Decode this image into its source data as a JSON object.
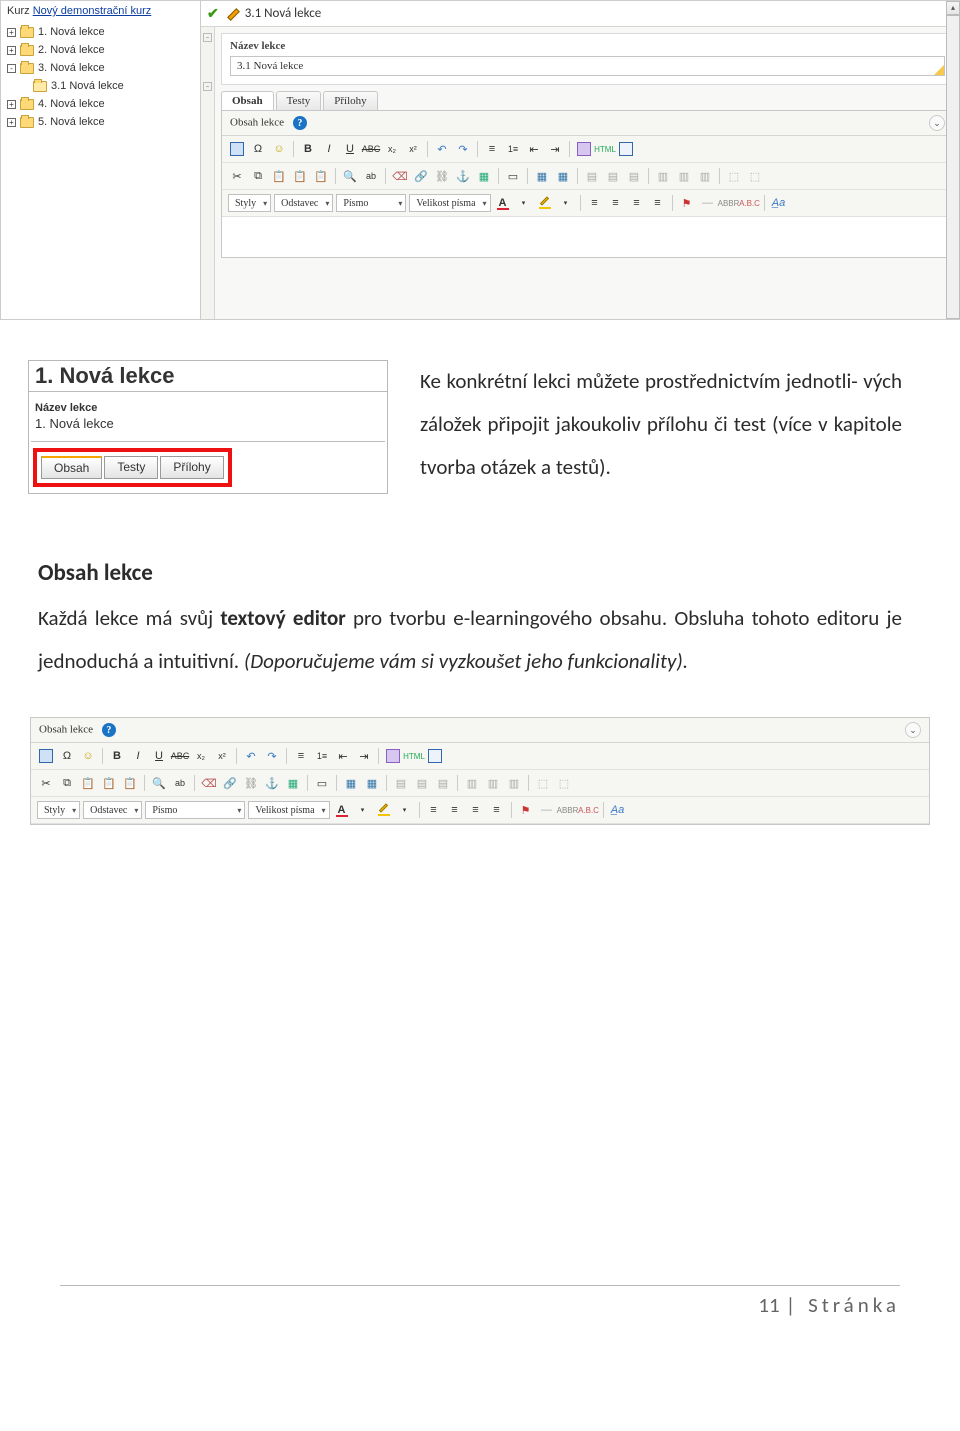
{
  "top_app": {
    "course_label": "Kurz",
    "course_link": "Nový demonstrační kurz",
    "tree": [
      {
        "exp": "+",
        "label": "1. Nová lekce"
      },
      {
        "exp": "+",
        "label": "2. Nová lekce"
      },
      {
        "exp": "-",
        "label": "3. Nová lekce"
      },
      {
        "exp": "",
        "label": "3.1 Nová lekce",
        "indent": true,
        "sub": true
      },
      {
        "exp": "+",
        "label": "4. Nová lekce"
      },
      {
        "exp": "+",
        "label": "5. Nová lekce"
      }
    ],
    "pane_title": "3.1 Nová lekce",
    "field_label": "Název lekce",
    "field_value": "3.1 Nová lekce",
    "tabs": [
      "Obsah",
      "Testy",
      "Přílohy"
    ],
    "editor_header": "Obsah lekce",
    "style_dd": "Styly",
    "para_dd": "Odstavec",
    "font_dd": "Písmo",
    "size_dd": "Velikost písma"
  },
  "mini": {
    "title": "1. Nová lekce",
    "field_label": "Název lekce",
    "field_value": "1. Nová lekce",
    "tabs": [
      "Obsah",
      "Testy",
      "Přílohy"
    ]
  },
  "para1_a": "Ke konkrétní lekci můžete prostřednictvím jednotli-",
  "para1_b": "vých záložek připojit jakoukoliv přílohu či test (více v kapitole tvorba otázek a testů).",
  "section_heading": "Obsah lekce",
  "para2": "Každá lekce má svůj textový editor pro tvorbu e-learningového obsahu. Obsluha tohoto editoru je jednoduchá a intuitivní. (Doporučujeme vám si vyzkoušet jeho funkcionality).",
  "wide_editor": {
    "header": "Obsah lekce",
    "style_dd": "Styly",
    "para_dd": "Odstavec",
    "font_dd": "Písmo",
    "size_dd": "Velikost písma"
  },
  "footer": {
    "page": "11",
    "label": "Stránka"
  }
}
